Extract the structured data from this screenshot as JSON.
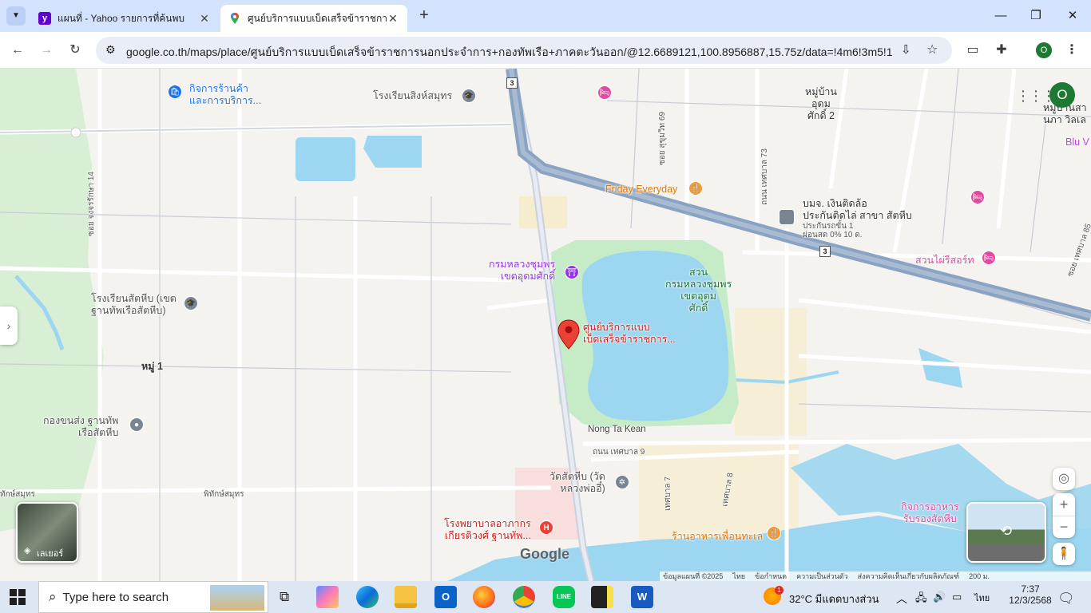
{
  "browser": {
    "tabs": [
      {
        "title": "แผนที่ - Yahoo รายการที่ค้นพบ",
        "favicon": "yahoo-icon",
        "color": "#6001d2"
      },
      {
        "title": "ศูนย์บริการแบบเบ็ดเสร็จข้าราชการนอกประจำการ",
        "favicon": "google-maps-icon",
        "color": "#34a853"
      }
    ],
    "new_tab": "+",
    "window_controls": {
      "minimize": "—",
      "maximize": "❐",
      "close": "✕"
    },
    "url": "google.co.th/maps/place/ศูนย์บริการแบบเบ็ดเสร็จข้าราชการนอกประจำการ+กองทัพเรือ+ภาคตะวันออก/@12.6689121,100.8956887,15.75z/data=!4m6!3m5!1s0x3102...",
    "profile_initial": "O"
  },
  "map": {
    "labels": {
      "shop_service": "กิจการร้านค้า\nและการบริการ...",
      "singhasamut_school": "โรงเรียนสิงห์สมุทร",
      "village_udom": "หมู่บ้าน\nอุดม\nศักดิ์ 2",
      "village_right": "หมู่บ้านสา\nนภา วิลเล",
      "blu": "Blu V",
      "friday": "Friday Everyday",
      "money": "บมจ. เงินติดล้อ\nประกันติดไล่ สาขา สัตหีบ",
      "money_sub": "ประกันรถขั้น 1\nผ่อนสด 0% 10 ด.",
      "park_rose": "สวนไผ่รีสอร์ท",
      "chumphon_shrine": "กรมหลวงชุมพร\nเขตอุดมศักดิ์",
      "park": "สวน\nกรมหลวงชุมพร\nเขตอุดม\nศักดิ์",
      "target": "ศูนย์บริการแบบ\nเบ็ดเสร็จข้าราชการ...",
      "sattahip_school": "โรงเรียนสัตหีบ (เขต\nฐานทัพเรือสัตหีบ)",
      "moo1": "หมู่ 1",
      "transport": "กองขนส่ง ฐานทัพ\nเรือสัตหีบ",
      "nongtakean": "Nong Ta Kean",
      "road_tessaban9": "ถนน เทศบาล 9",
      "wat": "วัดสัตหีบ (วัด\nหลวงพ่ออี๋)",
      "hospital": "โรงพยาบาลอาภากร\nเกียรติวงศ์ ฐานทัพ...",
      "food_right": "กิจการอาหาร\nรับรองสัตหีบ",
      "restaurant": "ร้านอาหารเพื่อนทะเล",
      "road_jongkarn": "ซอย จงจรรักษา 14",
      "road_sukhumvit": "ซอย สุขุมวิท 69",
      "road_tessaban73": "ถนน เทศบาล 73",
      "road_tessaban85": "ซอย เทศบาล 85",
      "road_t7": "เทศบาล 7",
      "road_t8": "เทศบาล 8",
      "pitak": "พิทักษ์สมุทร",
      "samut_left": "ทักษ์สมุทร",
      "highway": "3",
      "layers": "เลเยอร์",
      "google": "Google"
    },
    "footer": [
      "ข้อมูลแผนที่ ©2025",
      "ไทย",
      "ข้อกำหนด",
      "ความเป็นส่วนตัว",
      "ส่งความคิดเห็นเกี่ยวกับผลิตภัณฑ์",
      "200 ม."
    ],
    "colors": {
      "water": "#9cd6f0",
      "park": "#c5ecc7",
      "highway": "#8aa3c2",
      "pin": "#ea4335"
    }
  },
  "taskbar": {
    "search_placeholder": "Type here to search",
    "weather": "32°C  มีแดดบางส่วน",
    "lang": "ไทย",
    "time": "7:37",
    "date": "12/3/2568",
    "weather_badge": "1"
  }
}
